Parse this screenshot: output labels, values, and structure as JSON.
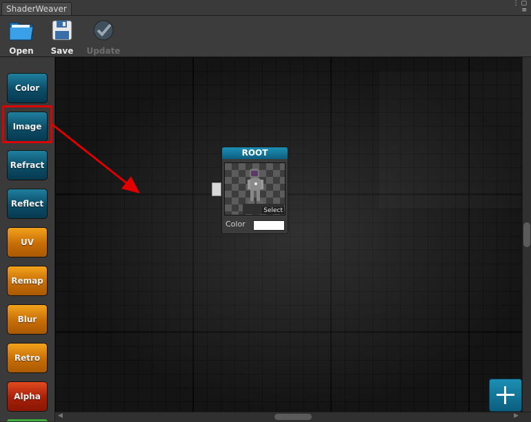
{
  "window": {
    "tab_title": "ShaderWeaver",
    "controls": [
      "⋮",
      "▢",
      "≡"
    ]
  },
  "toolbar": {
    "open_label": "Open",
    "save_label": "Save",
    "update_label": "Update"
  },
  "node_buttons": {
    "color": "Color",
    "image": "Image",
    "refract": "Refract",
    "reflect": "Reflect",
    "uv": "UV",
    "remap": "Remap",
    "blur": "Blur",
    "retro": "Retro",
    "alpha": "Alpha"
  },
  "root_node": {
    "title": "ROOT",
    "select_label": "Select",
    "color_label": "Color",
    "color_value": "#ffffff"
  },
  "colors": {
    "accent_blue": "#0d5f80",
    "node_orange": "#c66d06",
    "node_red": "#a51f07",
    "highlight_red": "#e00000"
  },
  "icons": {
    "open": "folder-icon",
    "save": "floppy-disk-icon",
    "update": "checkmark-icon",
    "add": "plus-icon"
  }
}
